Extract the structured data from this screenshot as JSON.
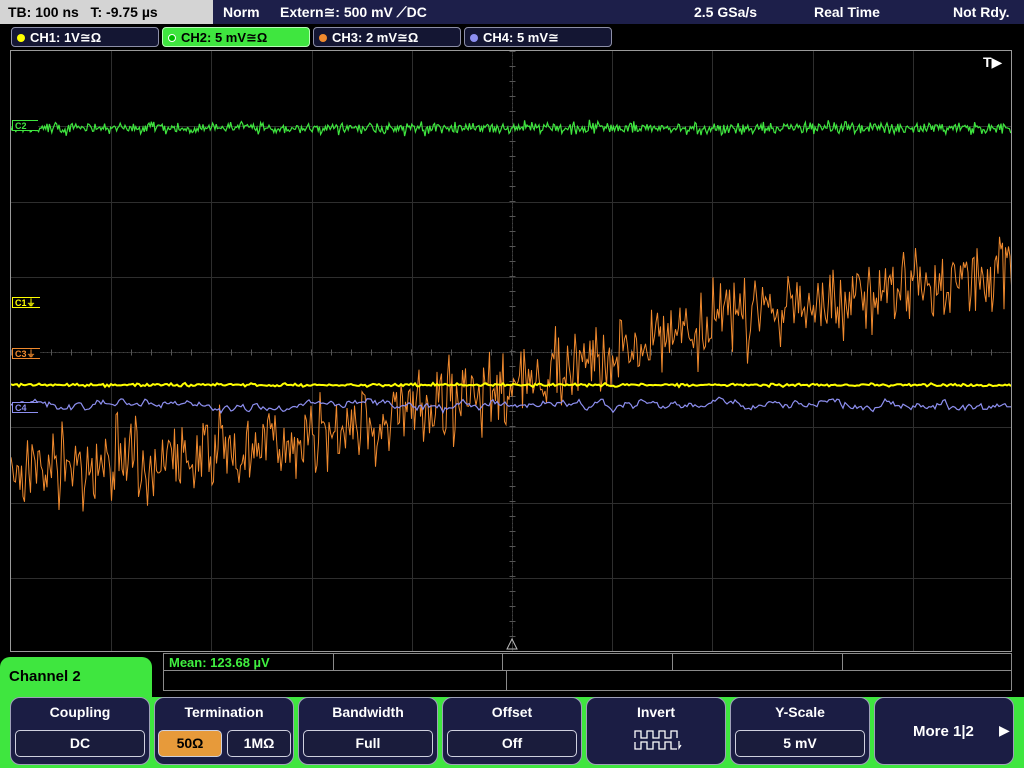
{
  "status": {
    "timebase": "TB: 100 ns",
    "trigger_time": "T: -9.75 µs",
    "mode": "Norm",
    "trigger_source": "Extern≅: 500 mV ⟋DC",
    "sample_rate": "2.5 GSa/s",
    "acq_mode": "Real Time",
    "state": "Not Rdy."
  },
  "channels": [
    {
      "label": "CH1: 1V≅Ω",
      "color": "#ffff00",
      "active": false
    },
    {
      "label": "CH2: 5 mV≅Ω",
      "color": "#3fe63f",
      "active": true
    },
    {
      "label": "CH3: 2 mV≅Ω",
      "color": "#f08a2e",
      "active": false
    },
    {
      "label": "CH4: 5 mV≅",
      "color": "#8d8ff0",
      "active": false
    }
  ],
  "display": {
    "trigger_pos_marker": "T▶",
    "markers": [
      {
        "label": "C1",
        "color": "#ffff00"
      },
      {
        "label": "C3",
        "color": "#f08a2e"
      },
      {
        "label": "C4",
        "color": "#8d8ff0"
      },
      {
        "label": "C2",
        "color": "#3fe63f"
      }
    ]
  },
  "measurement": {
    "mean": "Mean: 123.68 µV"
  },
  "menu": {
    "title": "Channel 2",
    "softkeys": {
      "coupling": {
        "title": "Coupling",
        "value": "DC"
      },
      "termination": {
        "title": "Termination",
        "option_50": "50Ω",
        "option_1m": "1MΩ",
        "selected": "50Ω"
      },
      "bandwidth": {
        "title": "Bandwidth",
        "value": "Full"
      },
      "offset": {
        "title": "Offset",
        "value": "Off"
      },
      "invert": {
        "title": "Invert"
      },
      "yscale": {
        "title": "Y-Scale",
        "value": "5 mV"
      },
      "more": {
        "label": "More 1|2",
        "arrow": "▶"
      }
    }
  },
  "colors": {
    "accent_green": "#3fe63f",
    "panel_bg": "#1b1d44"
  }
}
